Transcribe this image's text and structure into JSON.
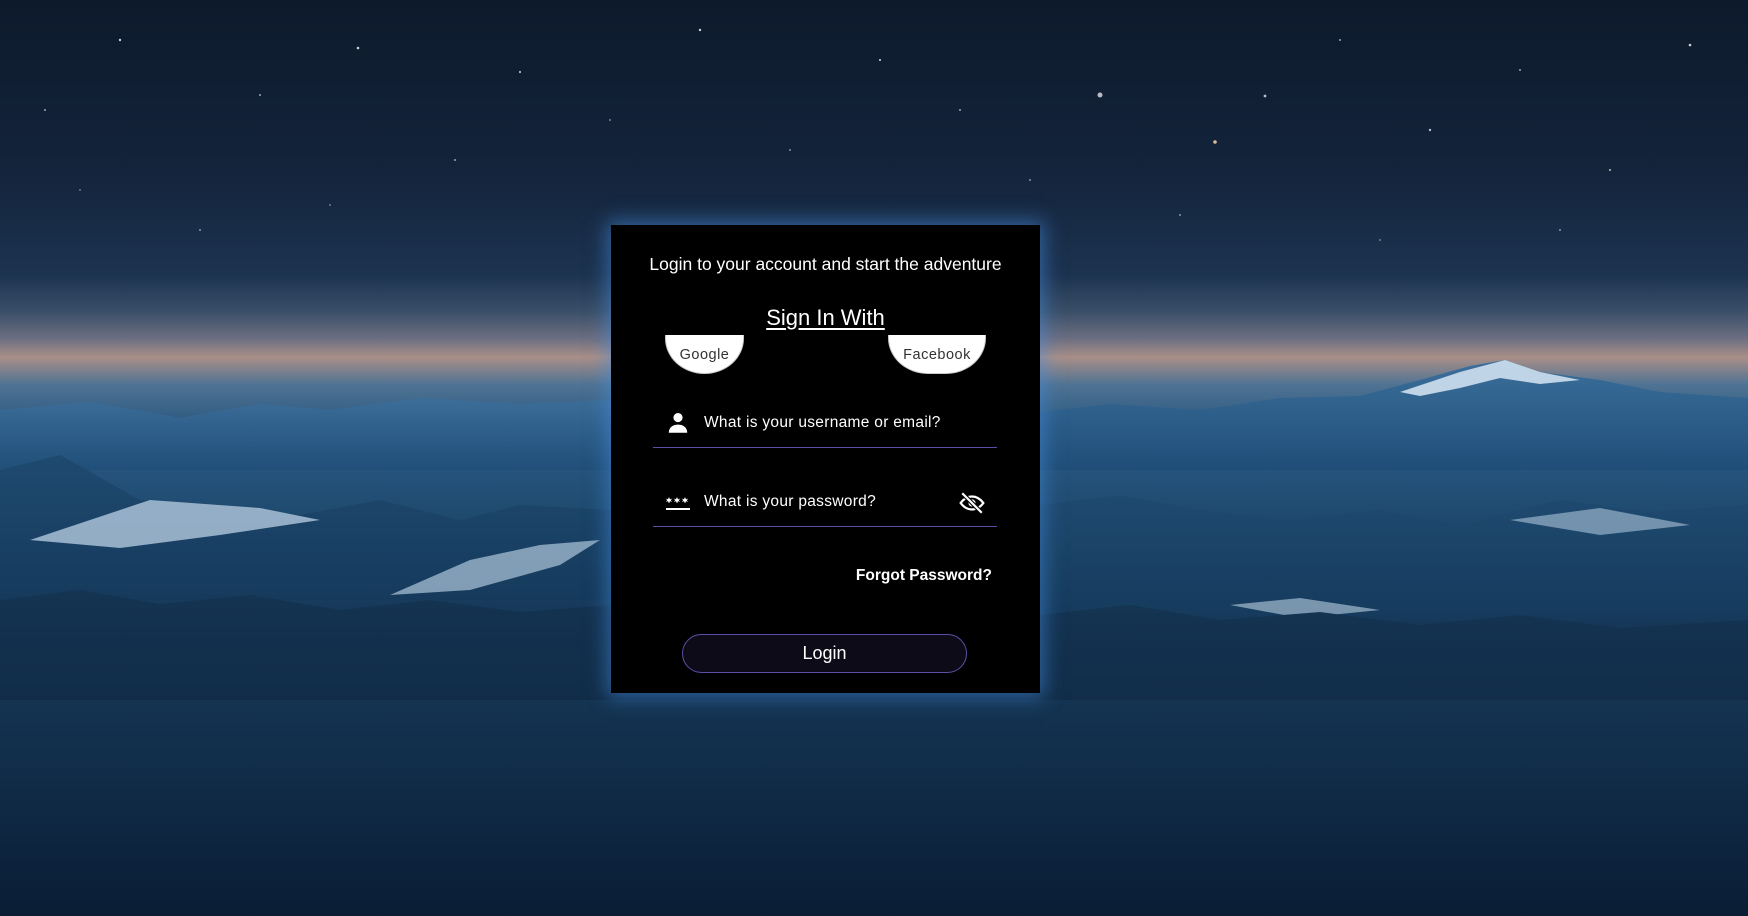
{
  "background": {
    "description_icon": "mountain-night-landscape"
  },
  "login_card": {
    "tagline": "Login to your account and start the adventure",
    "sign_in_heading": "Sign In With",
    "social": {
      "google_label": "Google",
      "facebook_label": "Facebook"
    },
    "username_field": {
      "placeholder": "What is your username or email?",
      "value": "",
      "icon": "person-icon"
    },
    "password_field": {
      "placeholder": "What is your password?",
      "value": "",
      "icon": "password-dots-icon",
      "toggle_icon": "eye-off-icon"
    },
    "forgot_password_label": "Forgot Password?",
    "login_button_label": "Login"
  },
  "colors": {
    "card_background": "#000000",
    "accent": "#5a4fa8",
    "glow": "#468cdc",
    "text": "#ffffff"
  }
}
